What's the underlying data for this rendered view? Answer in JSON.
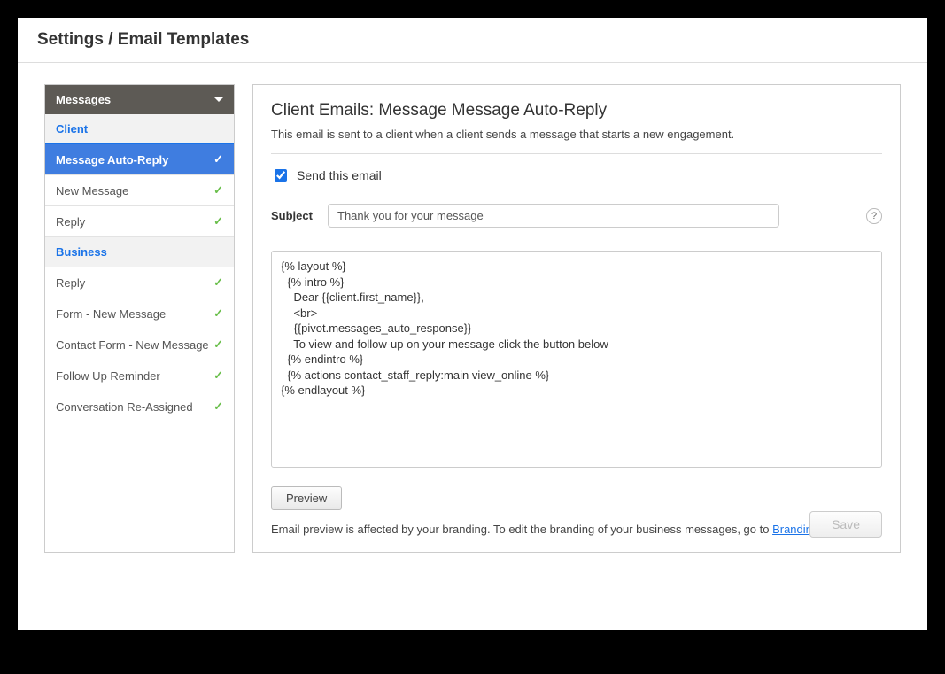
{
  "header": {
    "title": "Settings / Email Templates"
  },
  "sidebar": {
    "title": "Messages",
    "sections": [
      {
        "label": "Client",
        "items": [
          {
            "label": "Message Auto-Reply",
            "active": true
          },
          {
            "label": "New Message",
            "active": false
          },
          {
            "label": "Reply",
            "active": false
          }
        ]
      },
      {
        "label": "Business",
        "items": [
          {
            "label": "Reply",
            "active": false
          },
          {
            "label": "Form - New Message",
            "active": false
          },
          {
            "label": "Contact Form - New Message",
            "active": false
          },
          {
            "label": "Follow Up Reminder",
            "active": false
          },
          {
            "label": "Conversation Re-Assigned",
            "active": false
          }
        ]
      }
    ]
  },
  "main": {
    "heading": "Client Emails: Message Message Auto-Reply",
    "description": "This email is sent to a client when a client sends a message that starts a new engagement.",
    "send_label": "Send this email",
    "send_checked": true,
    "subject_label": "Subject",
    "subject_value": "Thank you for your message",
    "body_value": "{% layout %}\n  {% intro %}\n    Dear {{client.first_name}},\n    <br>\n    {{pivot.messages_auto_response}}\n    To view and follow-up on your message click the button below\n  {% endintro %}\n  {% actions contact_staff_reply:main view_online %}\n{% endlayout %}",
    "preview_label": "Preview",
    "preview_note_prefix": "Email preview is affected by your branding. To edit the branding of your business messages, go to ",
    "preview_note_link": "Branding Settings",
    "save_label": "Save",
    "help_symbol": "?"
  }
}
